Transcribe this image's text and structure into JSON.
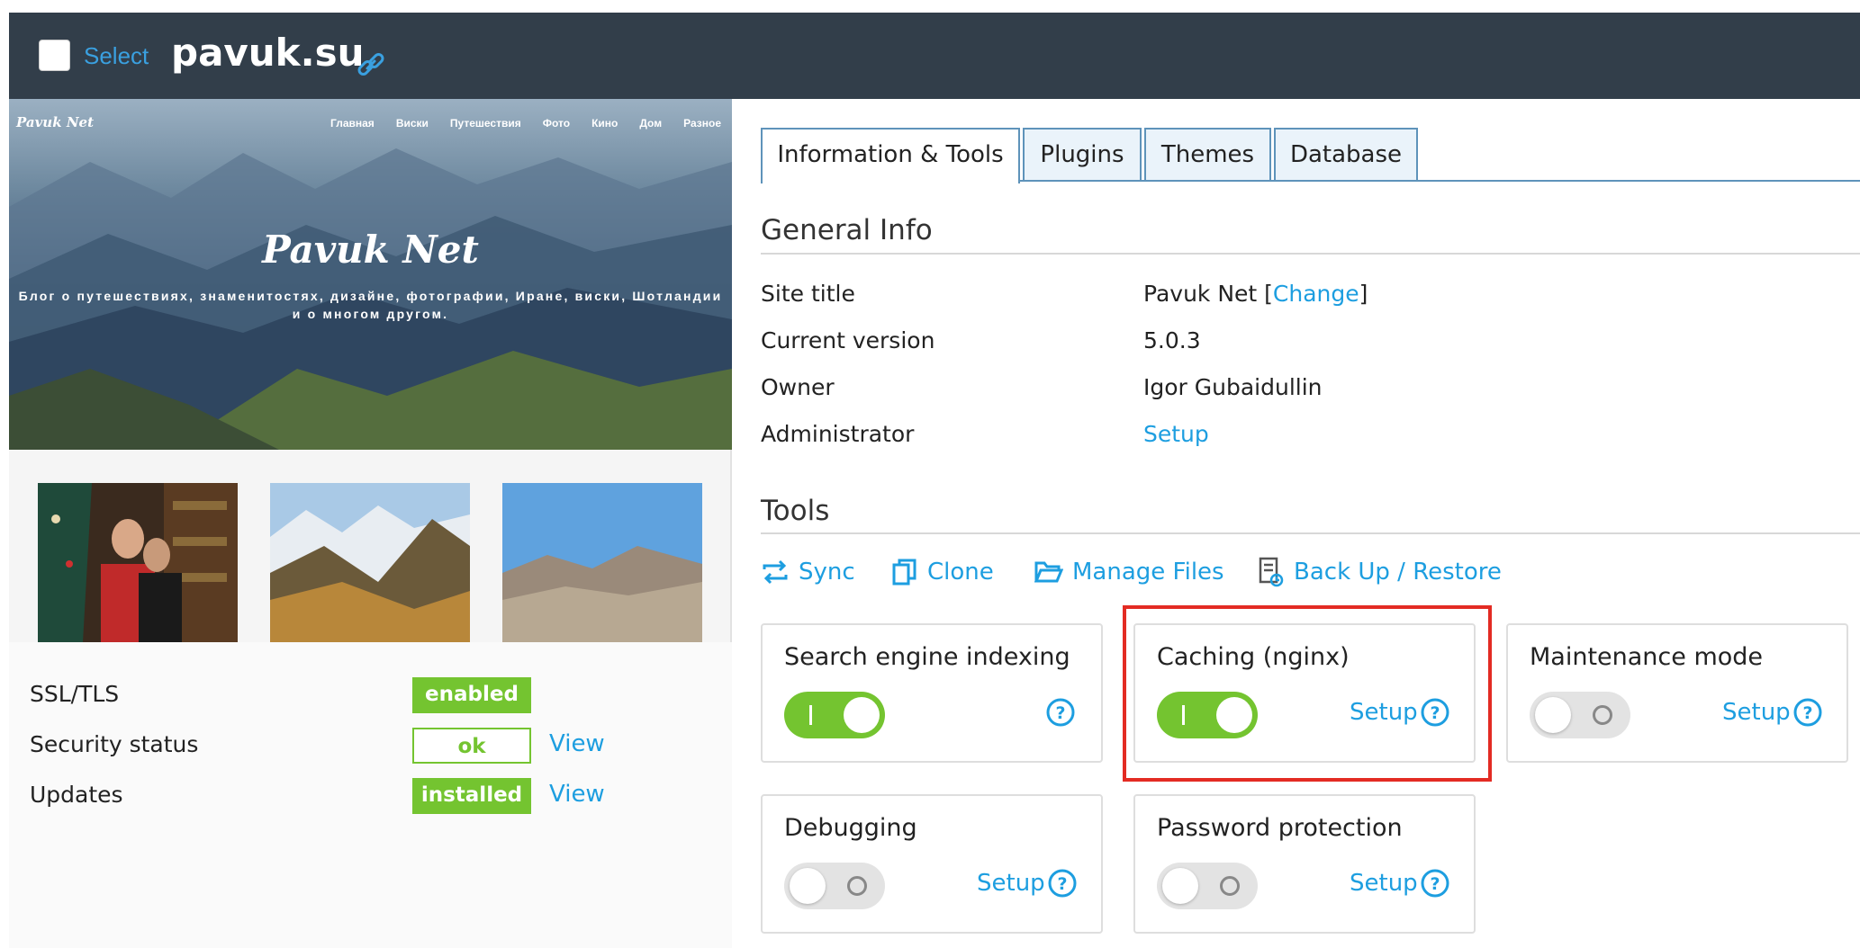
{
  "header": {
    "select_label": "Select",
    "domain": "pavuk.su"
  },
  "preview": {
    "brand": "Pavuk Net",
    "nav": [
      "Главная",
      "Виски",
      "Путешествия",
      "Фото",
      "Кино",
      "Дом",
      "Разное"
    ],
    "title": "Pavuk Net",
    "subtitle": "Блог о путешествиях, знаменитостях, дизайне, фотографии, Иране, виски, Шотландии и о многом другом."
  },
  "status": {
    "rows": [
      {
        "label": "SSL/TLS",
        "badge": "enabled",
        "badge_style": "filled",
        "link": ""
      },
      {
        "label": "Security status",
        "badge": "ok",
        "badge_style": "outline",
        "link": "View"
      },
      {
        "label": "Updates",
        "badge": "installed",
        "badge_style": "filled",
        "link": "View"
      }
    ]
  },
  "tabs": [
    "Information & Tools",
    "Plugins",
    "Themes",
    "Database"
  ],
  "active_tab": "Information & Tools",
  "general_info": {
    "heading": "General Info",
    "site_title_label": "Site title",
    "site_title_value": "Pavuk Net [",
    "site_title_change": "Change",
    "site_title_close": "]",
    "version_label": "Current version",
    "version_value": "5.0.3",
    "owner_label": "Owner",
    "owner_value": "Igor Gubaidullin",
    "admin_label": "Administrator",
    "admin_value": "Setup"
  },
  "tools": {
    "heading": "Tools",
    "links": [
      "Sync",
      "Clone",
      "Manage Files",
      "Back Up / Restore"
    ],
    "icons": [
      "sync-icon",
      "clone-icon",
      "folder-icon",
      "backup-icon"
    ]
  },
  "cards": [
    {
      "title": "Search engine indexing",
      "enabled": true,
      "setup": ""
    },
    {
      "title": "Caching (nginx)",
      "enabled": true,
      "setup": "Setup",
      "highlighted": true
    },
    {
      "title": "Maintenance mode",
      "enabled": false,
      "setup": "Setup"
    },
    {
      "title": "Debugging",
      "enabled": false,
      "setup": "Setup"
    },
    {
      "title": "Password protection",
      "enabled": false,
      "setup": "Setup"
    }
  ],
  "colors": {
    "header_bg": "#323e4a",
    "accent_blue": "#1d9ee0",
    "green": "#74c430",
    "highlight_red": "#e32b23"
  }
}
